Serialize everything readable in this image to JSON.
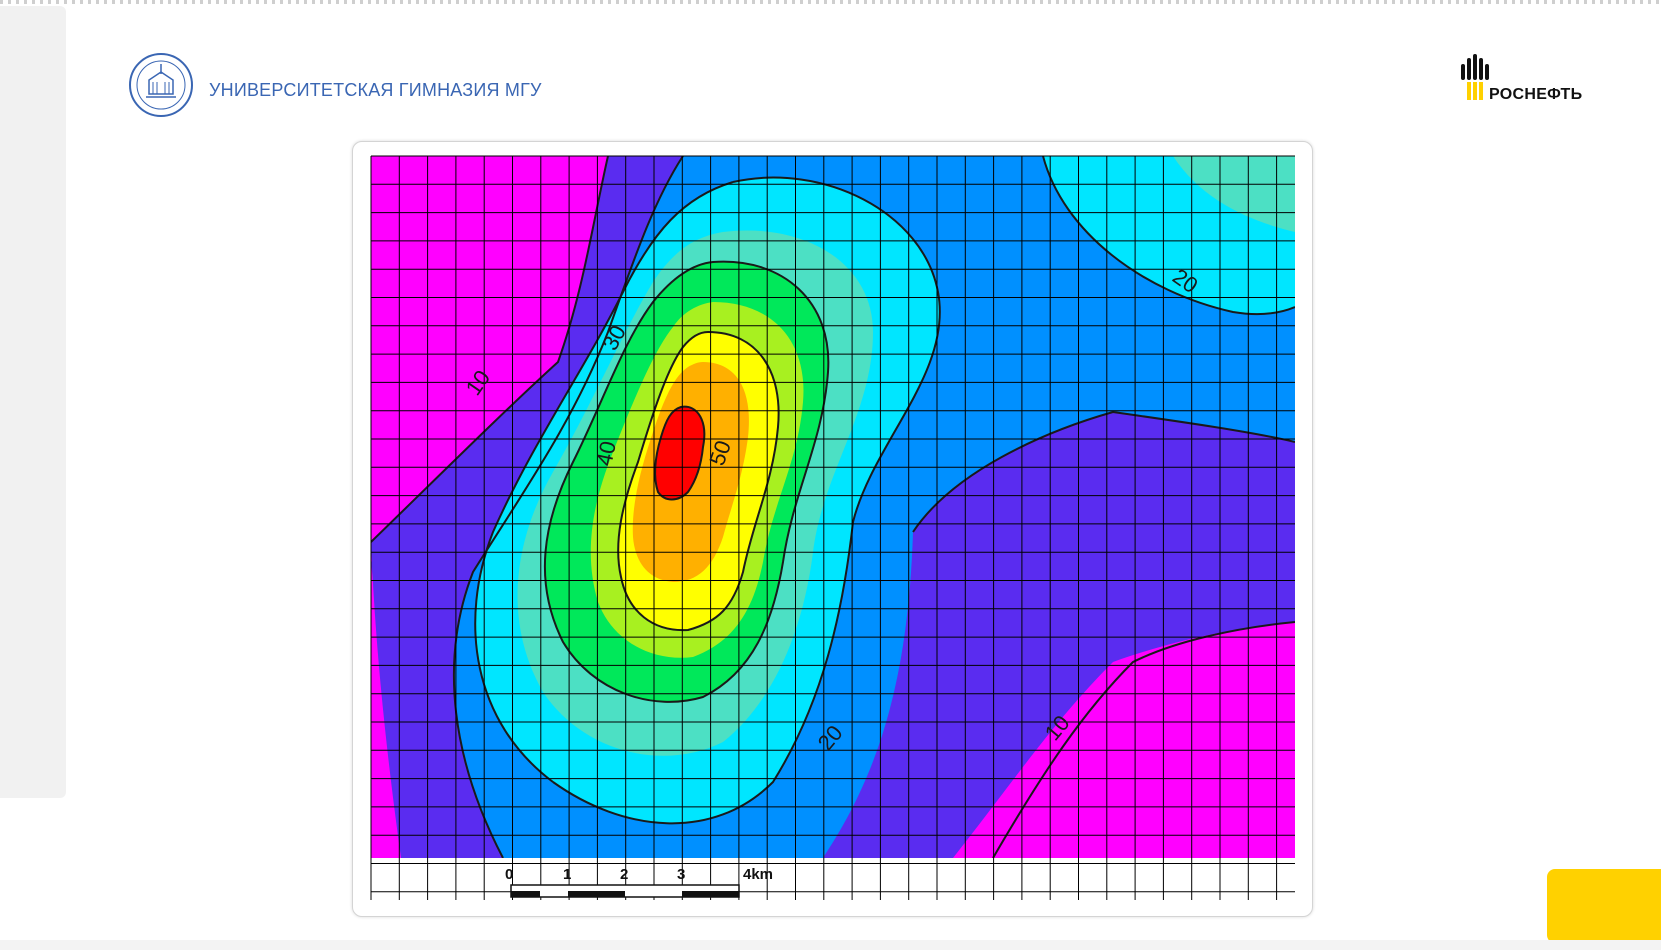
{
  "header": {
    "school_name": "УНИВЕРСИТЕТСКАЯ ГИМНАЗИЯ МГУ",
    "partner_logo_text": "РОСНЕФТЬ",
    "school_logo_icon": "university-seal-icon",
    "partner_logo_icon": "rosneft-flame-icon"
  },
  "map": {
    "contour_labels": [
      "10",
      "30",
      "40",
      "50",
      "20",
      "20",
      "10"
    ],
    "scale_labels": [
      "0",
      "1",
      "2",
      "3",
      "4km"
    ],
    "color_ramp": [
      "#ff00ff",
      "#5a2cf0",
      "#0090ff",
      "#00e6ff",
      "#4ce0c4",
      "#00e85a",
      "#a8f020",
      "#ffff00",
      "#ffb000",
      "#ff0000"
    ]
  },
  "colors": {
    "accent": "#ffd100",
    "school_text": "#3a66b3"
  }
}
